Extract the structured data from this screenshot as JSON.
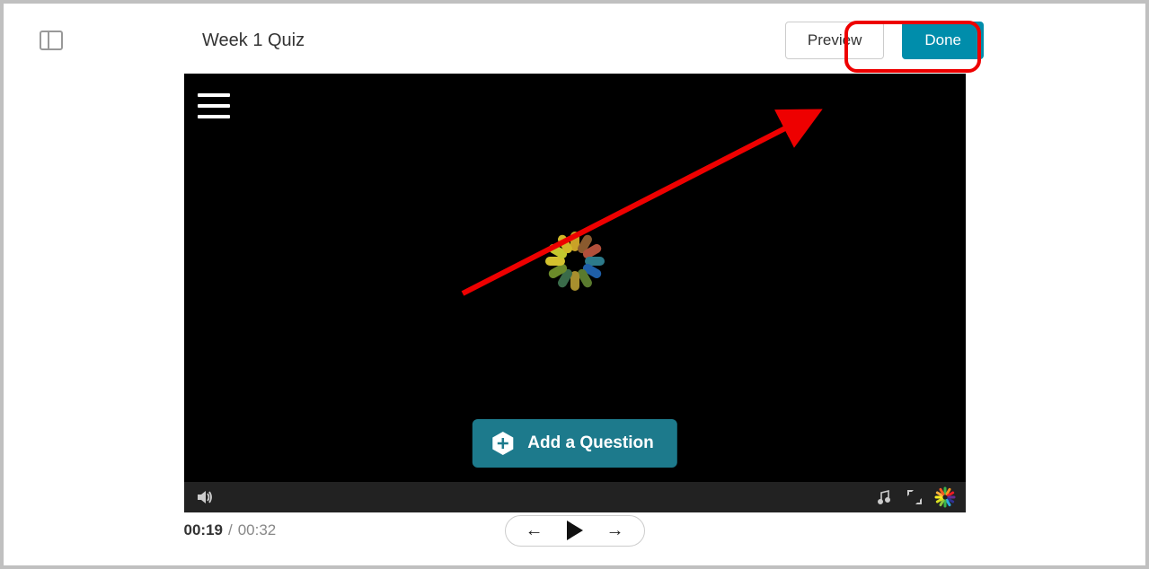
{
  "header": {
    "title": "Week 1 Quiz",
    "preview_label": "Preview",
    "done_label": "Done"
  },
  "video": {
    "add_question_label": "Add a Question"
  },
  "time": {
    "current": "00:19",
    "total": "00:32"
  },
  "colors": {
    "accent": "#008dab",
    "annotation": "#ee0000"
  }
}
